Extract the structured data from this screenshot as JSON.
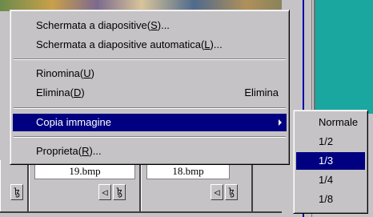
{
  "colors": {
    "menu_face": "#c6c3c6",
    "highlight": "#000080",
    "highlight_text": "#ffffff",
    "desktop_teal": "#1aa7a0"
  },
  "context_menu": {
    "items": [
      {
        "label": "Schermata a diapositive(",
        "mnemonic": "S",
        "suffix": ")..."
      },
      {
        "label": "Schermata a diapositive automatica(",
        "mnemonic": "L",
        "suffix": ")..."
      },
      {
        "label": "Rinomina(",
        "mnemonic": "U",
        "suffix": ")"
      },
      {
        "label": "Elimina(",
        "mnemonic": "D",
        "suffix": ")",
        "shortcut": "Elimina"
      },
      {
        "label": "Copia immagine",
        "submenu": true,
        "highlighted": true
      },
      {
        "label": "Proprieta(",
        "mnemonic": "R",
        "suffix": ")..."
      }
    ]
  },
  "submenu": {
    "items": [
      {
        "label": "Normale"
      },
      {
        "label": "1/2"
      },
      {
        "label": "1/3",
        "highlighted": true
      },
      {
        "label": "1/4"
      },
      {
        "label": "1/8"
      }
    ]
  },
  "thumbnails": [
    {
      "filename": "19.bmp",
      "icons": [
        "speaker-icon",
        "tag-icon"
      ]
    },
    {
      "filename": "18.bmp",
      "icons": [
        "speaker-icon",
        "tag-icon"
      ]
    }
  ]
}
